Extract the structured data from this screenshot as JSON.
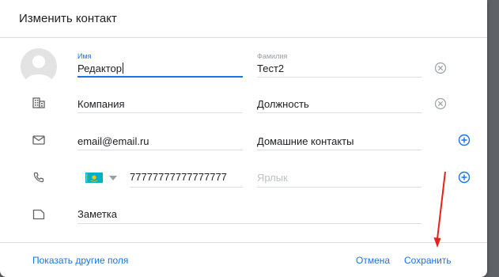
{
  "dialog": {
    "title": "Изменить контакт"
  },
  "name_row": {
    "first_name": {
      "label": "Имя",
      "value": "Редактор"
    },
    "last_name": {
      "label": "Фамилия",
      "value": "Тест2"
    }
  },
  "company_row": {
    "company": "Компания",
    "position": "Должность"
  },
  "email_row": {
    "email": "email@email.ru",
    "email_label": "Домашние контакты"
  },
  "phone_row": {
    "number": "77777777777777777",
    "label_placeholder": "Ярлык",
    "country": "Kazakhstan"
  },
  "note_row": {
    "note": "Заметка"
  },
  "footer": {
    "show_more": "Показать другие поля",
    "cancel": "Отмена",
    "save": "Сохранить"
  },
  "colors": {
    "accent": "#1a73e8",
    "annotation": "#e8201b"
  },
  "icons": {
    "avatar": "person-avatar-icon",
    "company": "building-icon",
    "email": "mail-icon",
    "phone": "phone-icon",
    "note": "note-icon",
    "clear": "clear-circle-icon",
    "add": "add-circle-icon",
    "flag": "kazakhstan-flag-icon",
    "dropdown": "dropdown-arrow-icon"
  }
}
